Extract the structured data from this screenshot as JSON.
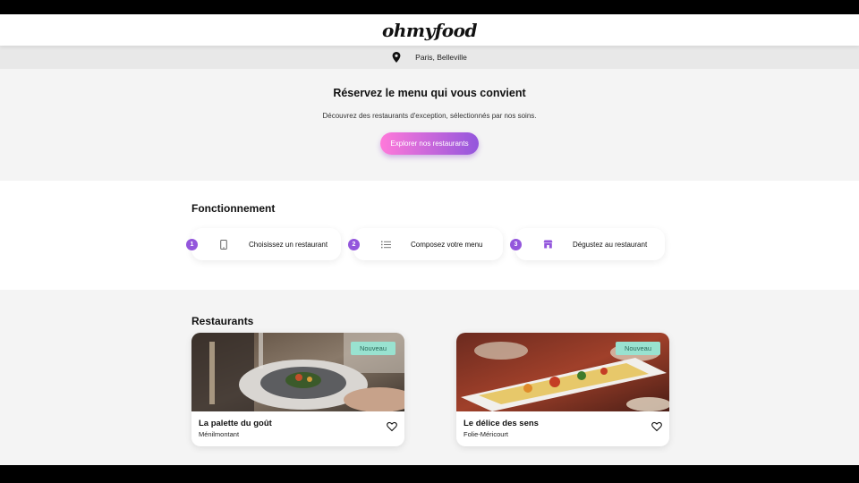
{
  "header": {
    "logo": "ohmyfood"
  },
  "location": {
    "icon": "map-pin-icon",
    "text": "Paris, Belleville"
  },
  "hero": {
    "title": "Réservez le menu qui vous convient",
    "subtitle": "Découvrez des restaurants d'exception, sélectionnés par nos soins.",
    "button_label": "Explorer nos restaurants"
  },
  "how": {
    "title": "Fonctionnement",
    "steps": [
      {
        "number": "1",
        "icon": "mobile-phone-icon",
        "label": "Choisissez un restaurant"
      },
      {
        "number": "2",
        "icon": "list-icon",
        "label": "Composez votre menu"
      },
      {
        "number": "3",
        "icon": "storefront-icon",
        "label": "Dégustez au restaurant"
      }
    ]
  },
  "restaurants": {
    "title": "Restaurants",
    "items": [
      {
        "name": "La palette du goût",
        "location": "Ménilmontant",
        "badge": "Nouveau",
        "image": "plated-dish-photo"
      },
      {
        "name": "Le délice des sens",
        "location": "Folie-Méricourt",
        "badge": "Nouveau",
        "image": "long-platter-photo"
      }
    ]
  },
  "colors": {
    "accent_start": "#ff79da",
    "accent_end": "#9356dc",
    "badge_bg": "#99e2d0"
  }
}
